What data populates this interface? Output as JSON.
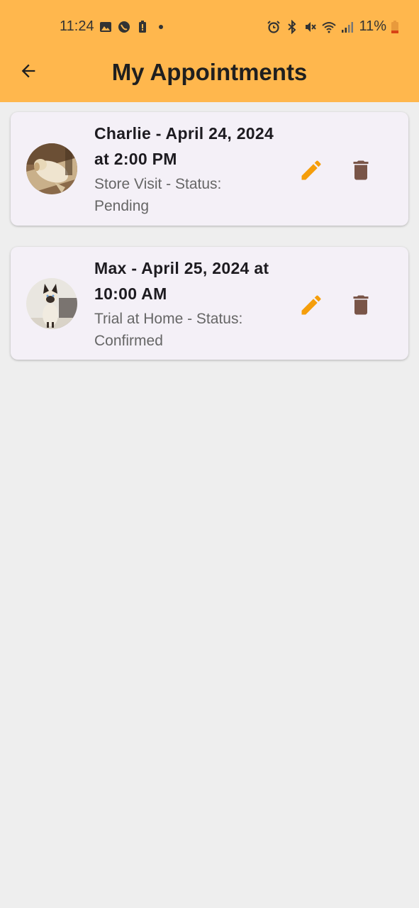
{
  "status_bar": {
    "time": "11:24",
    "battery": "11%",
    "left_icons": [
      "gallery-icon",
      "phone-icon",
      "battery-alert-icon",
      "dot-icon"
    ],
    "right_icons": [
      "alarm-icon",
      "bluetooth-icon",
      "mute-icon",
      "wifi-icon",
      "signal-icon",
      "battery-icon"
    ]
  },
  "appbar": {
    "title": "My Appointments",
    "color": "#ffb74d",
    "back_icon": "arrow-back-icon"
  },
  "appointments": [
    {
      "title": "Charlie - April 24, 2024 at 2:00 PM",
      "subtitle": "Store Visit - Status: Pending",
      "avatar": "dog-photo"
    },
    {
      "title": "Max - April 25, 2024 at 10:00 AM",
      "subtitle": "Trial at Home - Status: Confirmed",
      "avatar": "cat-photo"
    }
  ],
  "colors": {
    "edit": "#f59e0b",
    "delete": "#795548",
    "card_bg": "#f4f0f7",
    "page_bg": "#eeeeee"
  }
}
